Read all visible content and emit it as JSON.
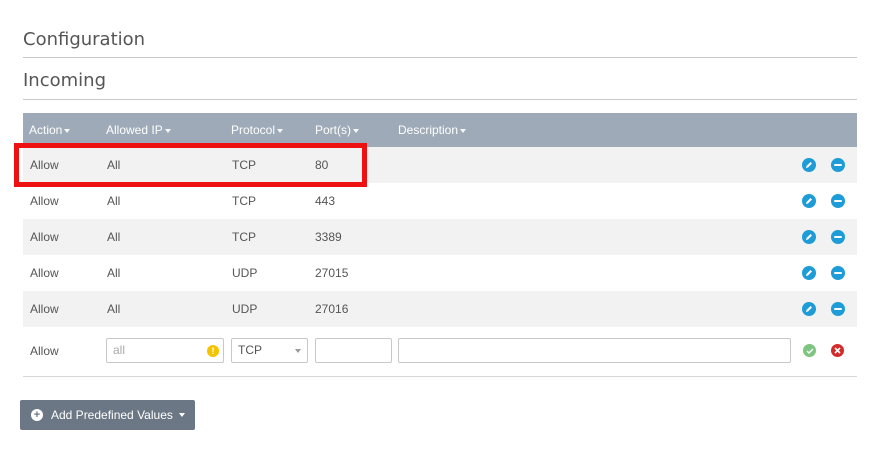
{
  "config_title": "Configuration",
  "incoming_title": "Incoming",
  "headers": {
    "action": "Action",
    "allowed_ip": "Allowed IP",
    "protocol": "Protocol",
    "ports": "Port(s)",
    "description": "Description"
  },
  "rows": [
    {
      "action": "Allow",
      "ip": "All",
      "protocol": "TCP",
      "port": "80",
      "description": ""
    },
    {
      "action": "Allow",
      "ip": "All",
      "protocol": "TCP",
      "port": "443",
      "description": ""
    },
    {
      "action": "Allow",
      "ip": "All",
      "protocol": "TCP",
      "port": "3389",
      "description": ""
    },
    {
      "action": "Allow",
      "ip": "All",
      "protocol": "UDP",
      "port": "27015",
      "description": ""
    },
    {
      "action": "Allow",
      "ip": "All",
      "protocol": "UDP",
      "port": "27016",
      "description": ""
    }
  ],
  "new_row": {
    "action": "Allow",
    "ip_placeholder": "all",
    "protocol": "TCP",
    "port": "",
    "description": ""
  },
  "add_button_label": "Add Predefined Values",
  "icons": {
    "edit": "pencil-icon",
    "remove": "minus-icon",
    "warning": "warning-icon",
    "confirm": "check-icon",
    "cancel": "close-icon",
    "add": "plus-icon"
  },
  "colors": {
    "header_bg": "#9eaab8",
    "action_blue": "#1e9cd7",
    "confirm_green": "#7cc47f",
    "cancel_red": "#d12b2b",
    "highlight_red": "#ee1111",
    "button_bg": "#6b7785"
  }
}
